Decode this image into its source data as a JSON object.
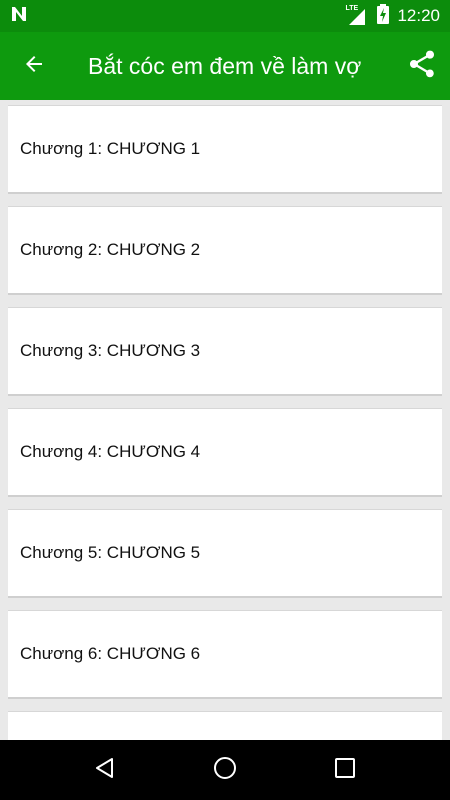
{
  "status_bar": {
    "time": "12:20",
    "network": "LTE",
    "icons": [
      "n-notification-icon",
      "signal-icon",
      "battery-charging-icon"
    ]
  },
  "app_bar": {
    "title": "Bắt cóc em đem về làm vợ",
    "back_icon": "arrow-left-icon",
    "share_icon": "share-icon",
    "color": "#0e9a0e"
  },
  "chapters": [
    {
      "label": "Chương 1: CHƯƠNG 1"
    },
    {
      "label": "Chương 2: CHƯƠNG 2"
    },
    {
      "label": "Chương 3: CHƯƠNG 3"
    },
    {
      "label": "Chương 4: CHƯƠNG 4"
    },
    {
      "label": "Chương 5: CHƯƠNG 5"
    },
    {
      "label": "Chương 6: CHƯƠNG 6"
    },
    {
      "label": ""
    }
  ],
  "nav_bar": {
    "icons": [
      "back-triangle-icon",
      "home-circle-icon",
      "recents-square-icon"
    ]
  }
}
